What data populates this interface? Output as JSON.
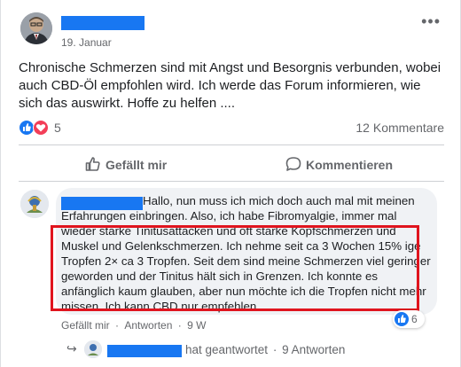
{
  "post": {
    "date": "19. Januar",
    "more_glyph": "•••",
    "text": "Chronische Schmerzen sind mit Angst und Besorgnis verbunden, wobei auch CBD-Öl empfohlen wird. Ich werde das Forum informieren, wie sich das auswirkt. Hoffe zu helfen ....",
    "reaction_count": "5",
    "comments_count": "12 Kommentare",
    "reactions": [
      "like-icon",
      "love-icon"
    ]
  },
  "actions": {
    "like_label": "Gefällt mir",
    "comment_label": "Kommentieren"
  },
  "comment": {
    "text": "Hallo, nun muss ich mich doch auch mal mit meinen Erfahrungen einbringen. Also, ich habe Fibromyalgie, immer mal wieder starke Tinitusattacken und oft starke Kopfschmerzen und Muskel und Gelenkschmerzen. Ich nehme seit ca 3 Wochen 15% ige Tropfen 2× ca 3 Tropfen. Seit dem sind meine Schmerzen viel geringer geworden und der Tinitus hält sich in Grenzen. Ich konnte es anfänglich kaum glauben, aber nun möchte ich die Tropfen nicht mehr missen. Ich kann CBD nur empfehlen.",
    "reaction_count": "6",
    "like_label": "Gefällt mir",
    "separator": "·",
    "reply_label": "Antworten",
    "age": "9 W"
  },
  "reply": {
    "arrow": "↪",
    "answered_label": "hat geantwortet",
    "separator": "·",
    "replies_label": "9 Antworten"
  },
  "colors": {
    "redaction": "#1877f2",
    "highlight": "#e0141e",
    "like": "#1877f2",
    "love": "#f33e58"
  }
}
